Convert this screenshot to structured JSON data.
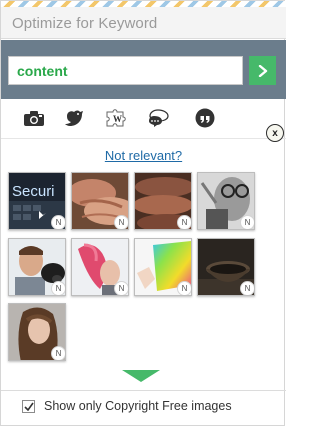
{
  "panel": {
    "title": "Optimize for Keyword"
  },
  "search": {
    "value": "content",
    "go_label": ">"
  },
  "sources": [
    {
      "name": "camera-icon"
    },
    {
      "name": "twitter-bird-icon"
    },
    {
      "name": "wikipedia-puzzle-icon"
    },
    {
      "name": "speech-bubbles-icon"
    },
    {
      "name": "quote-icon"
    }
  ],
  "close_label": "x",
  "not_relevant_label": "Not relevant?",
  "images": [
    {
      "name": "security-keyboard",
      "badge": "N",
      "caption": "Securi"
    },
    {
      "name": "elderly-hands",
      "badge": "N"
    },
    {
      "name": "hands-closeup",
      "badge": "N"
    },
    {
      "name": "man-with-glasses",
      "badge": "N"
    },
    {
      "name": "man-with-dog",
      "badge": "N"
    },
    {
      "name": "pink-hair-woman",
      "badge": "N"
    },
    {
      "name": "colorful-tablet",
      "badge": "N"
    },
    {
      "name": "dark-bowl",
      "badge": "N"
    },
    {
      "name": "woman-portrait",
      "badge": "N"
    }
  ],
  "footer": {
    "checkbox_checked": true,
    "checkbox_label": "Show only Copyright Free images"
  },
  "colors": {
    "accent_green": "#46b96a",
    "keyword_text": "#2aa84a",
    "search_bg": "#6b7d8c",
    "link_blue": "#1f6aa6"
  }
}
